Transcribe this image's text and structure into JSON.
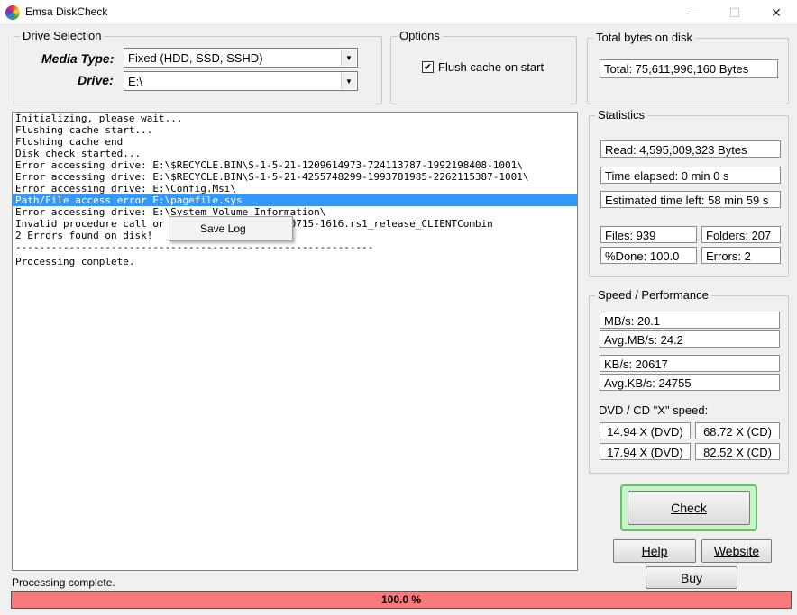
{
  "window": {
    "title": "Emsa DiskCheck",
    "minimize": "—",
    "maximize": "☐",
    "close": "✕"
  },
  "drive_selection": {
    "title": "Drive Selection",
    "media_type_label": "Media Type:",
    "media_type_value": "Fixed (HDD, SSD, SSHD)",
    "drive_label": "Drive:",
    "drive_value": "E:\\"
  },
  "options": {
    "title": "Options",
    "flush_cache_label": "Flush cache on start",
    "flush_cache_checked": true
  },
  "total_bytes": {
    "title": "Total bytes on disk",
    "value": "Total: 75,611,996,160 Bytes"
  },
  "statistics": {
    "title": "Statistics",
    "read": "Read: 4,595,009,323 Bytes",
    "time_elapsed": "Time elapsed: 0 min 0 s",
    "time_left": "Estimated time left: 58 min 59 s",
    "files": "Files:  939",
    "folders": "Folders:  207",
    "done": "%Done:  100.0",
    "errors": "Errors:  2"
  },
  "speed": {
    "title": "Speed / Performance",
    "mbs": "MB/s: 20.1",
    "avg_mbs": "Avg.MB/s: 24.2",
    "kbs": "KB/s: 20617",
    "avg_kbs": "Avg.KB/s: 24755",
    "dvd_label": "DVD / CD \"X\" speed:",
    "dvd1": "14.94 X (DVD)",
    "cd1": "68.72 X (CD)",
    "dvd2": "17.94 X (DVD)",
    "cd2": "82.52 X (CD)"
  },
  "log": {
    "lines": [
      "Initializing, please wait...",
      "Flushing cache start...",
      "Flushing cache end",
      "Disk check started...",
      "Error accessing drive: E:\\$RECYCLE.BIN\\S-1-5-21-1209614973-724113787-1992198408-1001\\",
      "Error accessing drive: E:\\$RECYCLE.BIN\\S-1-5-21-4255748299-1993781985-2262115387-1001\\",
      "Error accessing drive: E:\\Config.Msi\\",
      "Path/File access error E:\\pagefile.sys",
      "Error accessing drive: E:\\System Volume Information\\",
      "Invalid procedure call or argu                      rade\\14393.0.160715-1616.rs1_release_CLIENTCombin",
      "2 Errors found on disk!",
      "------------------------------------------------------------",
      "Processing complete."
    ],
    "selected_index": 7
  },
  "context_menu": {
    "save_log": "Save Log"
  },
  "buttons": {
    "check": "Check",
    "help": "Help",
    "website": "Website",
    "buy": "Buy"
  },
  "status": {
    "text": "Processing complete.",
    "progress_label": "100.0 %",
    "progress_fraction": 1.0,
    "progress_color": "#f77a7a"
  }
}
